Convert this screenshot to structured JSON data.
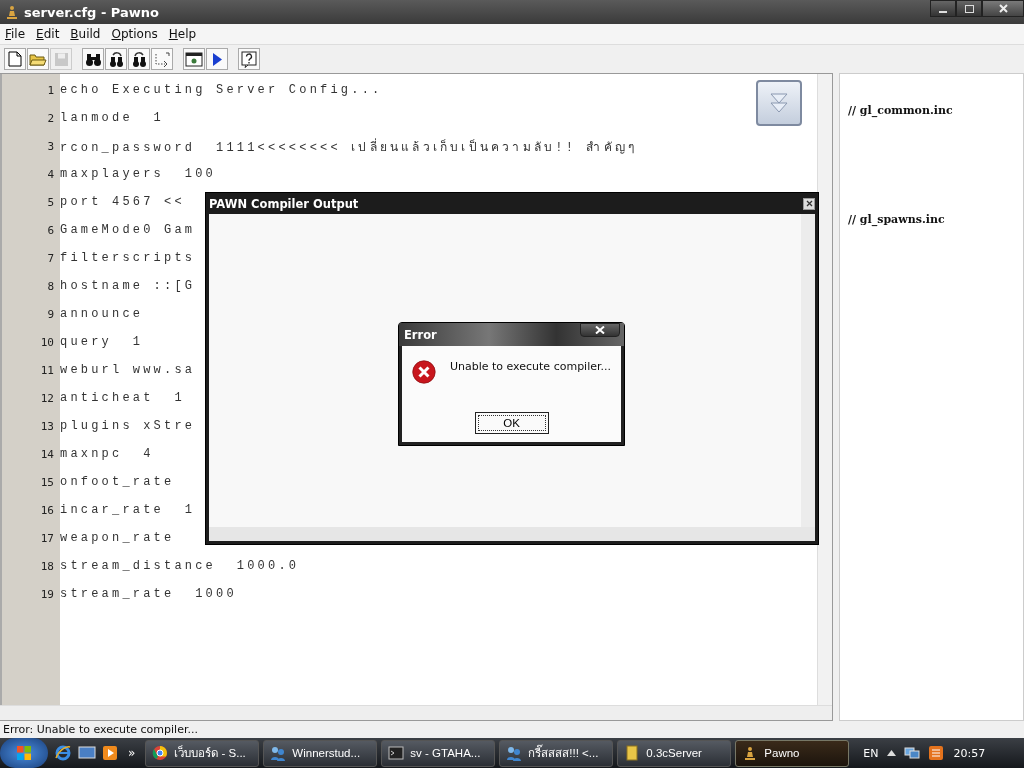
{
  "window": {
    "title": "server.cfg - Pawno"
  },
  "menu": [
    {
      "label": "File"
    },
    {
      "label": "Edit"
    },
    {
      "label": "Build"
    },
    {
      "label": "Options"
    },
    {
      "label": "Help"
    }
  ],
  "toolbar": [
    {
      "kind": "new",
      "disabled": false
    },
    {
      "kind": "open",
      "disabled": false
    },
    {
      "kind": "save",
      "disabled": true
    },
    {
      "kind": "find",
      "disabled": false
    },
    {
      "kind": "find-next",
      "disabled": false
    },
    {
      "kind": "replace",
      "disabled": false
    },
    {
      "kind": "goto",
      "disabled": false
    },
    {
      "kind": "options",
      "disabled": false
    },
    {
      "kind": "run",
      "disabled": false
    },
    {
      "kind": "help",
      "disabled": false
    }
  ],
  "editor": {
    "lines": [
      {
        "number": "1",
        "text": "echo Executing Server Config..."
      },
      {
        "number": "2",
        "text": "lanmode  1"
      },
      {
        "number": "3",
        "text": "rcon_password  1111<<<<<<<< เปลี่ยนแล้วเก็บเป็นความลับ!! สำคัญๆ"
      },
      {
        "number": "4",
        "text": "maxplayers  100"
      },
      {
        "number": "5",
        "text": "port 4567 <<"
      },
      {
        "number": "6",
        "text": "GameMode0 Gam"
      },
      {
        "number": "7",
        "text": "filterscripts"
      },
      {
        "number": "8",
        "text": "hostname ::[G"
      },
      {
        "number": "9",
        "text": "announce"
      },
      {
        "number": "10",
        "text": "query  1"
      },
      {
        "number": "11",
        "text": "weburl www.sa"
      },
      {
        "number": "12",
        "text": "anticheat  1"
      },
      {
        "number": "13",
        "text": "plugins xStre"
      },
      {
        "number": "14",
        "text": "maxnpc  4"
      },
      {
        "number": "15",
        "text": "onfoot_rate"
      },
      {
        "number": "16",
        "text": "incar_rate  1"
      },
      {
        "number": "17",
        "text": "weapon_rate"
      },
      {
        "number": "18",
        "text": "stream_distance  1000.0"
      },
      {
        "number": "19",
        "text": "stream_rate  1000"
      }
    ]
  },
  "side_panel": {
    "items": [
      {
        "text": "// gl_common.inc"
      },
      {
        "text": "// gl_spawns.inc"
      }
    ]
  },
  "compiler_output": {
    "title": "PAWN Compiler Output"
  },
  "error_dialog": {
    "title": "Error",
    "message": "Unable to execute compiler...",
    "button": "OK"
  },
  "status_bar": {
    "text": "Error: Unable to execute compiler..."
  },
  "taskbar": {
    "quick_launch": [
      "»"
    ],
    "tasks": [
      {
        "label": "เว็บบอร์ด - S...",
        "kind": "browser",
        "selected": false
      },
      {
        "label": "Winnerstud...",
        "kind": "messenger",
        "selected": false
      },
      {
        "label": "sv - GTAHA...",
        "kind": "console",
        "selected": false
      },
      {
        "label": "กรี๊สสสส!!! <...",
        "kind": "messenger",
        "selected": false
      },
      {
        "label": "0.3cServer",
        "kind": "folder",
        "selected": false
      },
      {
        "label": "Pawno",
        "kind": "pawno",
        "selected": true
      }
    ],
    "language": "EN",
    "time": "20:57"
  }
}
